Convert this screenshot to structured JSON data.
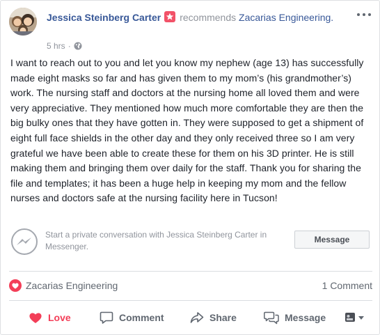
{
  "post": {
    "author": "Jessica Steinberg Carter",
    "action_text": "recommends",
    "page": "Zacarias Engineering.",
    "time": "5 hrs",
    "body": "I want to reach out to you and let you know my nephew (age 13) has successfully made eight masks so far and has given them to my mom’s (his grandmother’s) work. The nursing staff and doctors at the nursing home all loved them and were very appreciative. They mentioned how much more comfortable they are then the big bulky ones that they have gotten in. They were supposed to get a shipment of eight full face shields in the other day and they only received three so I am very grateful we have been able to create these for them on his 3D printer. He is still making them and bringing them over daily for the staff. Thank you for sharing the file and templates; it has been a huge help in keeping my mom and the fellow nurses and doctors safe at the nursing facility here in Tucson!"
  },
  "messenger": {
    "prompt": "Start a private conversation with Jessica Steinberg Carter in Messenger.",
    "button_label": "Message"
  },
  "reactions": {
    "name": "Zacarias Engineering",
    "comments": "1 Comment"
  },
  "actions": {
    "love": "Love",
    "comment": "Comment",
    "share": "Share",
    "message": "Message"
  },
  "colors": {
    "link": "#385898",
    "love": "#f33e58",
    "badge": "#f25268"
  },
  "icons": [
    "avatar",
    "recommend-star-icon",
    "globe-icon",
    "more-options-icon",
    "messenger-icon",
    "heart-icon",
    "comment-icon",
    "share-icon",
    "message-icon",
    "audience-selector-icon"
  ]
}
